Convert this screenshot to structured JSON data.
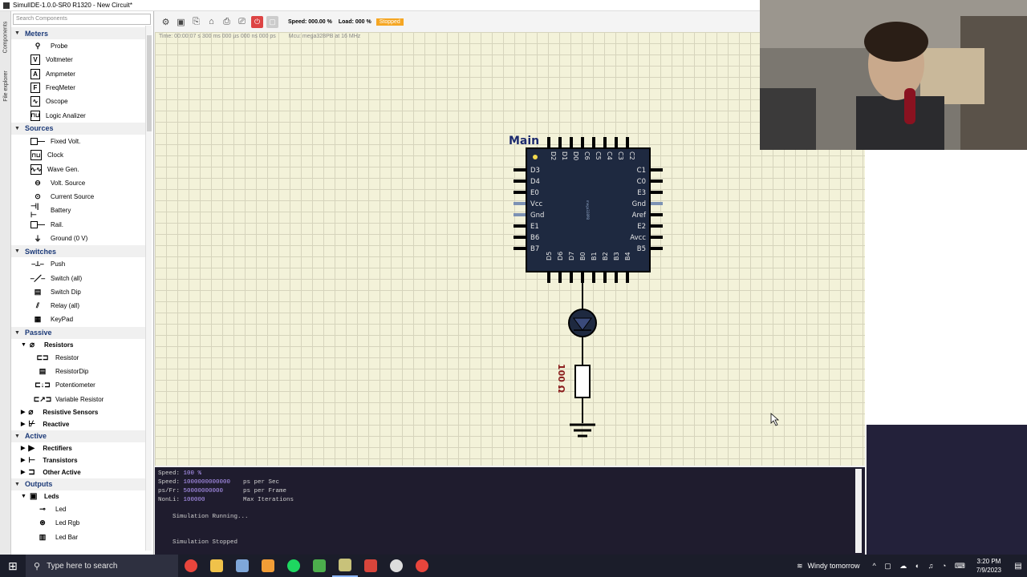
{
  "window": {
    "title": "SimulIDE-1.0.0-SR0 R1320 - New Circuit*"
  },
  "vtabs": [
    "Components",
    "File explorer"
  ],
  "panel": {
    "search_placeholder": "Search Components",
    "categories": [
      {
        "label": "Meters",
        "items": [
          "Probe",
          "Voltmeter",
          "Ampmeter",
          "FreqMeter",
          "Oscope",
          "Logic Analizer"
        ]
      },
      {
        "label": "Sources",
        "items": [
          "Fixed Volt.",
          "Clock",
          "Wave Gen.",
          "Volt. Source",
          "Current Source",
          "Battery",
          "Rail.",
          "Ground (0 V)"
        ]
      },
      {
        "label": "Switches",
        "items": [
          "Push",
          "Switch (all)",
          "Switch Dip",
          "Relay (all)",
          "KeyPad"
        ]
      },
      {
        "label": "Passive",
        "sub_resistors": "Resistors",
        "items": [
          "Resistor",
          "ResistorDip",
          "Potentiometer",
          "Variable Resistor"
        ],
        "sub_resistive_sensors": "Resistive Sensors",
        "sub_reactive": "Reactive"
      },
      {
        "label": "Active",
        "subs": [
          "Rectifiers",
          "Transistors",
          "Other Active"
        ]
      },
      {
        "label": "Outputs",
        "sub_leds": "Leds",
        "items": [
          "Led",
          "Led Rgb",
          "Led Bar"
        ]
      }
    ]
  },
  "toolbar": {
    "speed": "Speed: 000.00 %",
    "load": "Load: 000 %",
    "state": "Stopped"
  },
  "canvas": {
    "time": "Time: 00:00:07 s  300 ms  000 µs  000 ns  000 ps",
    "mcu": "Mcu: mega328PB at 16 MHz",
    "chip": {
      "label": "Main",
      "top_pins": [
        "D2",
        "D1",
        "D0",
        "C6",
        "C5",
        "C4",
        "C3",
        "C2"
      ],
      "left_pins": [
        "D3",
        "D4",
        "E0",
        "Vcc",
        "Gnd",
        "E1",
        "B6",
        "B7"
      ],
      "right_pins": [
        "C1",
        "C0",
        "E3",
        "Gnd",
        "Aref",
        "E2",
        "Avcc",
        "B5"
      ],
      "bottom_pins": [
        "D5",
        "D6",
        "D7",
        "B0",
        "B1",
        "B2",
        "B3",
        "B4"
      ],
      "part_text": "mega328PB"
    },
    "resistor_value": "100 Ω"
  },
  "console": {
    "speed_pct_label": "Speed:",
    "speed_pct": "100 %",
    "speed_ps_label": "Speed:",
    "speed_ps": "1000000000000",
    "speed_ps_unit": "ps per Sec",
    "psfr_label": "ps/Fr:",
    "psfr": "50000000000",
    "psfr_unit": "ps per Frame",
    "nonli_label": "NonLi:",
    "nonli": "100000",
    "nonli_unit": "Max Iterations",
    "msg_running": "Simulation Running...",
    "msg_stopped": "Simulation Stopped"
  },
  "taskbar": {
    "search_placeholder": "Type here to search",
    "weather": "Windy tomorrow",
    "time": "3:20 PM",
    "date": "7/9/2023"
  },
  "colors": {
    "canvas": "#f3f2d9",
    "chip": "#1e2940",
    "console_bg": "#1f1c2e",
    "badge": "#f5a623"
  }
}
